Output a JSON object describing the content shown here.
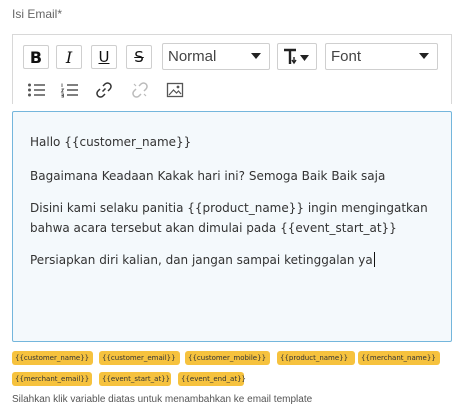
{
  "field": {
    "label": "Isi Email*"
  },
  "toolbar": {
    "buttons": [
      {
        "name": "bold-button",
        "icon": "bold-icon",
        "glyph": "B"
      },
      {
        "name": "italic-button",
        "icon": "italic-icon",
        "glyph": "I"
      },
      {
        "name": "underline-button",
        "icon": "underline-icon",
        "glyph": "U"
      },
      {
        "name": "strikethrough-button",
        "icon": "strikethrough-icon",
        "glyph": "S"
      }
    ],
    "format_select": {
      "value": "Normal"
    },
    "text_size_icon": "text-size-icon",
    "font_select": {
      "value": "Font"
    },
    "list_buttons": [
      "bulleted-list-icon",
      "numbered-list-icon",
      "link-icon",
      "unlink-icon",
      "image-icon"
    ]
  },
  "editor": {
    "paragraphs": [
      "Hallo {{customer_name}}",
      "Bagaimana Keadaan Kakak hari ini? Semoga Baik Baik saja",
      "Disini kami selaku panitia {{product_name}} ingin mengingatkan bahwa acara tersebut akan dimulai pada {{event_start_at}}",
      "Persiapkan diri kalian, dan jangan sampai ketinggalan ya"
    ]
  },
  "variables": [
    "{{customer_name}}",
    "{{customer_email}}",
    "{{customer_mobile}}",
    "{{product_name}}",
    "{{merchant_name}}",
    "{{merchant_email}}",
    "{{event_start_at}}",
    "{{event_end_at}}"
  ],
  "hint": "Silahkan klik variable diatas untuk menambahkan ke email template",
  "colors": {
    "accent_border": "#74b6dc",
    "chip_bg": "#f6c23e",
    "editor_bg": "#f4f9fc"
  }
}
